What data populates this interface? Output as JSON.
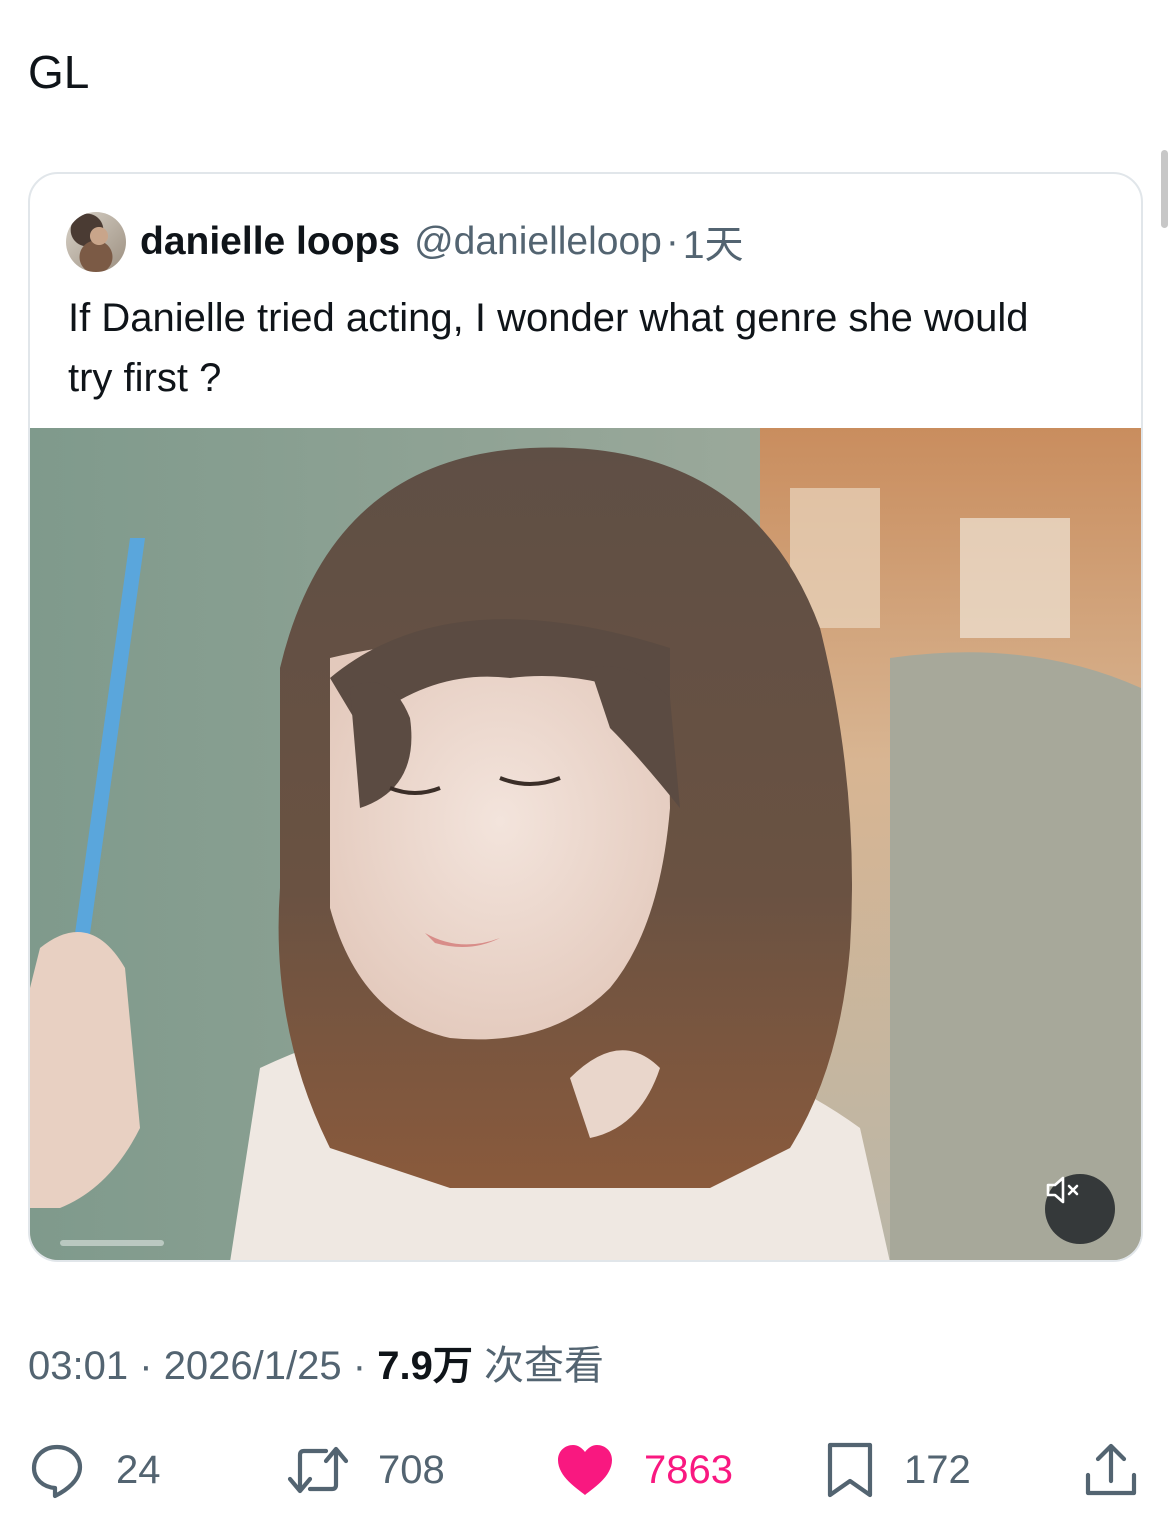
{
  "tweet": {
    "text": "GL"
  },
  "quote": {
    "author_name": "danielle loops",
    "author_handle": "@danielleloop",
    "separator": "·",
    "time_ago": "1天",
    "body": "If Danielle tried acting, I wonder what genre she would try first ?",
    "media": {
      "type": "video",
      "muted": true
    }
  },
  "meta": {
    "time": "03:01",
    "date": "2026/1/25",
    "views_value": "7.9万",
    "views_label": "次查看",
    "dot": "·"
  },
  "actions": {
    "reply_count": "24",
    "retweet_count": "708",
    "like_count": "7863",
    "bookmark_count": "172",
    "like_active": true
  },
  "colors": {
    "accent_like": "#f91880",
    "secondary_text": "#536471",
    "primary_text": "#0f1419"
  },
  "icons": [
    "reply-icon",
    "retweet-icon",
    "heart-icon",
    "bookmark-icon",
    "share-icon",
    "volume-muted-icon"
  ]
}
